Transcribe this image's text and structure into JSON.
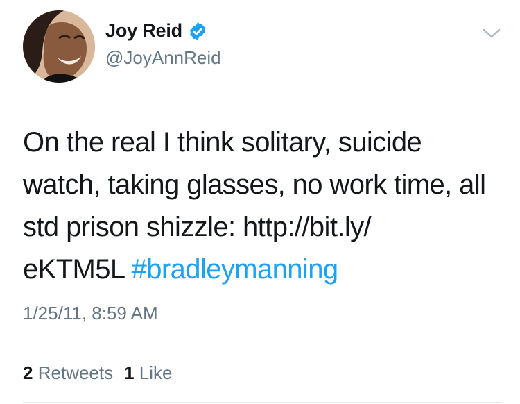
{
  "tweet": {
    "display_name": "Joy Reid",
    "handle": "@JoyAnnReid",
    "text_lines": [
      "On the real I think solitary, suicide",
      "watch, taking glasses, no work time, all",
      "std prison shizzle: http://bit.ly/",
      "eKTM5L"
    ],
    "hashtag": "#bradleymanning",
    "timestamp": "1/25/11, 8:59 AM"
  },
  "stats": {
    "retweets_count": "2",
    "retweets_label": "Retweets",
    "likes_count": "1",
    "likes_label": "Like"
  },
  "icons": {
    "verified": "verified-badge-icon",
    "caret": "chevron-down-icon"
  },
  "colors": {
    "link": "#1da1f2",
    "secondary_text": "#657786",
    "primary_text": "#14171a",
    "divider": "#e1e8ed"
  }
}
